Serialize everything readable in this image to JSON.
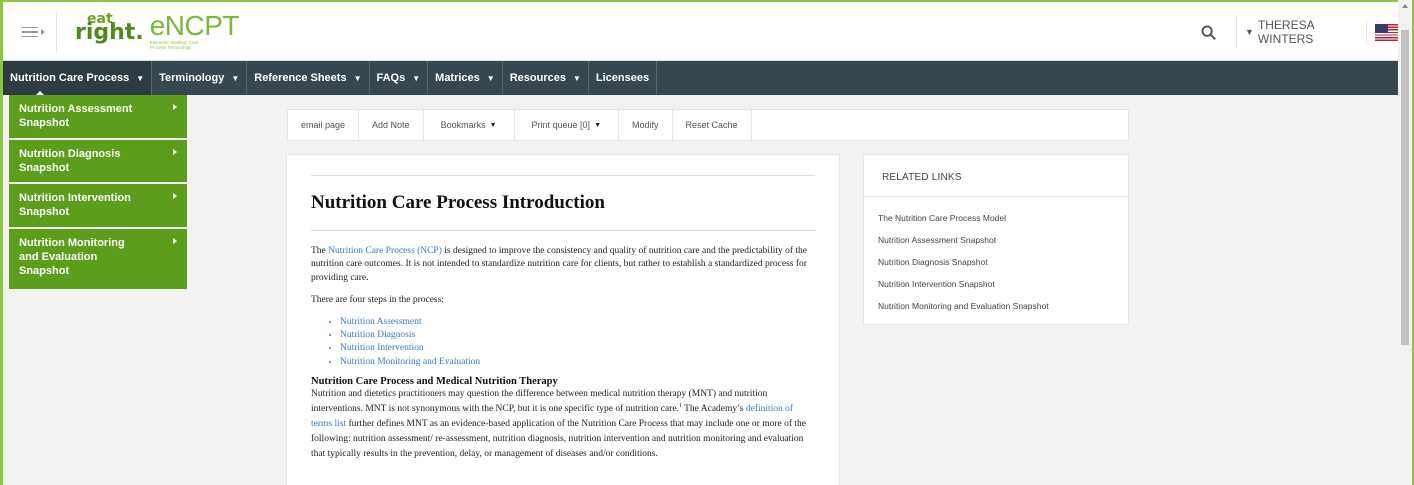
{
  "header": {
    "logo_top": "eat",
    "logo_bottom": "right.",
    "brand": "eNCPT",
    "brand_sub": "Electronic Nutrition Care Process Terminology",
    "user_name": "THERESA WINTERS",
    "icons": [
      "menu-icon",
      "search-icon",
      "chevron-down-icon",
      "us-flag-icon"
    ]
  },
  "nav": {
    "items": [
      {
        "label": "Nutrition Care Process",
        "dropdown": true
      },
      {
        "label": "Terminology",
        "dropdown": true
      },
      {
        "label": "Reference Sheets",
        "dropdown": true
      },
      {
        "label": "FAQs",
        "dropdown": true
      },
      {
        "label": "Matrices",
        "dropdown": true
      },
      {
        "label": "Resources",
        "dropdown": true
      },
      {
        "label": "Licensees",
        "dropdown": false
      }
    ]
  },
  "dropdown": {
    "items": [
      "Nutrition Assessment Snapshot",
      "Nutrition Diagnosis Snapshot",
      "Nutrition Intervention Snapshot",
      "Nutrition Monitoring and Evaluation Snapshot"
    ]
  },
  "toolbar": {
    "email": "email page",
    "note": "Add Note",
    "bookmarks": "Bookmarks",
    "print": "Print queue [0]",
    "modify": "Modify",
    "reset": "Reset Cache"
  },
  "article": {
    "title": "Nutrition Care Process Introduction",
    "p1_pre": "The ",
    "p1_link": "Nutrition Care Process (NCP)",
    "p1_post": " is designed to improve the consistency and quality of nutrition care and the predictability of the nutrition care outcomes. It is not intended to standardize nutrition care for clients, but rather to establish a standardized process for providing care.",
    "p2": "There are four steps in the process:",
    "steps": [
      "Nutrition Assessment",
      "Nutrition Diagnosis",
      "Nutrition Intervention",
      "Nutrition Monitoring and Evaluation"
    ],
    "subheading": "Nutrition Care Process and Medical Nutrition Therapy",
    "p3_a": "Nutrition and dietetics practitioners may question the difference between medical nutrition therapy (MNT) and nutrition interventions. MNT is not synonymous with the NCP, but it is one specific type of nutrition care.",
    "p3_sup": "1",
    "p3_b": " The Academy’s ",
    "p3_link": "definition of terms list",
    "p3_c": " further defines MNT as an evidence-based application of the Nutrition Care Process that may include one or more of the following: nutrition assessment/ re-assessment, nutrition diagnosis, nutrition intervention and nutrition monitoring and evaluation that typically results in the prevention, delay, or management of diseases and/or conditions."
  },
  "related": {
    "heading": "RELATED LINKS",
    "links": [
      "The Nutrition Care Process Model",
      "Nutrition Assessment Snapshot",
      "Nutrition Diagnosis Snapshot",
      "Nutrition Intervention Snapshot",
      "Nutrition Monitoring and Evaluation Snapshot"
    ]
  },
  "colors": {
    "brand_green": "#8cc63f",
    "menu_green": "#5a9e1c",
    "nav_bg": "#37474f",
    "link": "#3a7abf"
  }
}
